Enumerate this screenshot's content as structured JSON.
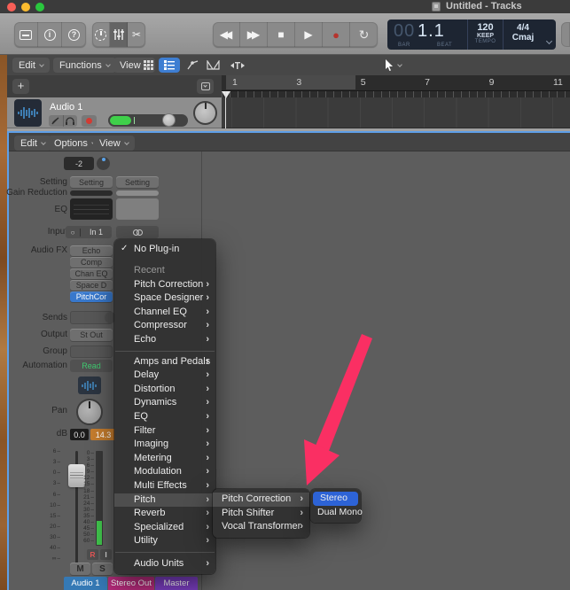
{
  "window": {
    "title": "Untitled - Tracks"
  },
  "toolbar": {
    "lcd": {
      "bar_prefix": "00",
      "position": "1.1",
      "bar_label": "BAR",
      "beat_label": "BEAT",
      "tempo": "120",
      "tempo_mode": "KEEP",
      "tempo_label": "TEMPO",
      "time_signature": "4/4",
      "key": "Cmaj"
    }
  },
  "tracks_window": {
    "menus": {
      "edit": "Edit",
      "functions": "Functions",
      "view": "View"
    },
    "add_track": "+",
    "ruler_numbers": [
      "1",
      "3",
      "5",
      "7",
      "9",
      "11"
    ],
    "track_name": "Audio 1"
  },
  "mixer": {
    "menus": {
      "edit": "Edit",
      "options": "Options",
      "view": "View"
    },
    "labels": [
      "Setting",
      "Gain Reduction",
      "EQ",
      "Input",
      "Audio FX",
      "Sends",
      "Output",
      "Group",
      "Automation",
      "Pan",
      "dB"
    ],
    "channel1": {
      "gain": "-2",
      "setting": "Setting",
      "input_mode": "○",
      "input": "In 1",
      "fx": [
        "Echo",
        "Comp",
        "Chan EQ",
        "Space D",
        "PitchCor"
      ],
      "output": "St Out",
      "automation": "Read",
      "db_value": "0.0",
      "db_peak": "14.3",
      "record": "R",
      "input_monitor": "I",
      "mute": "M",
      "solo": "S",
      "name": "Audio 1"
    },
    "channel2": {
      "setting": "Setting",
      "name": "Stereo Out"
    },
    "channel3": {
      "name": "Master"
    },
    "fader_scale": [
      "6",
      "3",
      "0",
      "3",
      "6",
      "10",
      "15",
      "20",
      "30",
      "40",
      "∞"
    ],
    "meter_scale": [
      "0",
      "3",
      "6",
      "9",
      "12",
      "15",
      "18",
      "21",
      "24",
      "30",
      "35",
      "40",
      "45",
      "50",
      "60"
    ]
  },
  "plugin_menu": {
    "no_plugin": "No Plug-in",
    "recent_header": "Recent",
    "recent": [
      "Pitch Correction",
      "Space Designer",
      "Channel EQ",
      "Compressor",
      "Echo"
    ],
    "categories": [
      "Amps and Pedals",
      "Delay",
      "Distortion",
      "Dynamics",
      "EQ",
      "Filter",
      "Imaging",
      "Metering",
      "Modulation",
      "Multi Effects",
      "Pitch",
      "Reverb",
      "Specialized",
      "Utility"
    ],
    "highlighted_category": "Pitch",
    "audio_units": "Audio Units",
    "pitch_submenu": {
      "items": [
        "Pitch Correction",
        "Pitch Shifter",
        "Vocal Transformer"
      ],
      "highlighted": "Pitch Correction"
    },
    "format_submenu": {
      "items": [
        "Stereo",
        "Dual Mono"
      ],
      "highlighted": "Stereo"
    }
  },
  "colors": {
    "selection_blue": "#2d63d6",
    "pitchcor_blue": "#3878cc",
    "peak_orange": "#c57c2d",
    "read_green": "#3fca70",
    "audio1_blue": "#3579b5",
    "stereo_out_magenta": "#b72c7c",
    "master_purple": "#7b3ec1",
    "annotation_pink": "#fa2f63"
  }
}
